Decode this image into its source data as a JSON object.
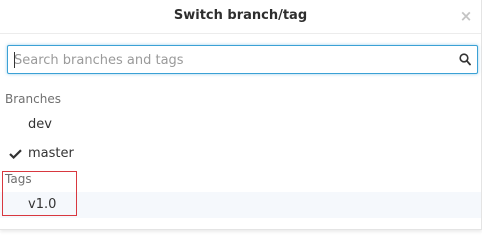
{
  "dialog": {
    "title": "Switch branch/tag",
    "close_glyph": "×"
  },
  "search": {
    "placeholder": "Search branches and tags",
    "value": ""
  },
  "branches": {
    "heading": "Branches",
    "items": [
      {
        "label": "dev",
        "selected": false
      },
      {
        "label": "master",
        "selected": true
      }
    ]
  },
  "tags": {
    "heading": "Tags",
    "items": [
      {
        "label": "v1.0",
        "selected": false
      }
    ]
  },
  "icons": {
    "search": "search-icon",
    "check": "check-icon",
    "close": "close-icon"
  },
  "colors": {
    "accent": "#3ba1d5",
    "highlight_box": "#d8383f",
    "hover_row": "#f5f8fc"
  }
}
